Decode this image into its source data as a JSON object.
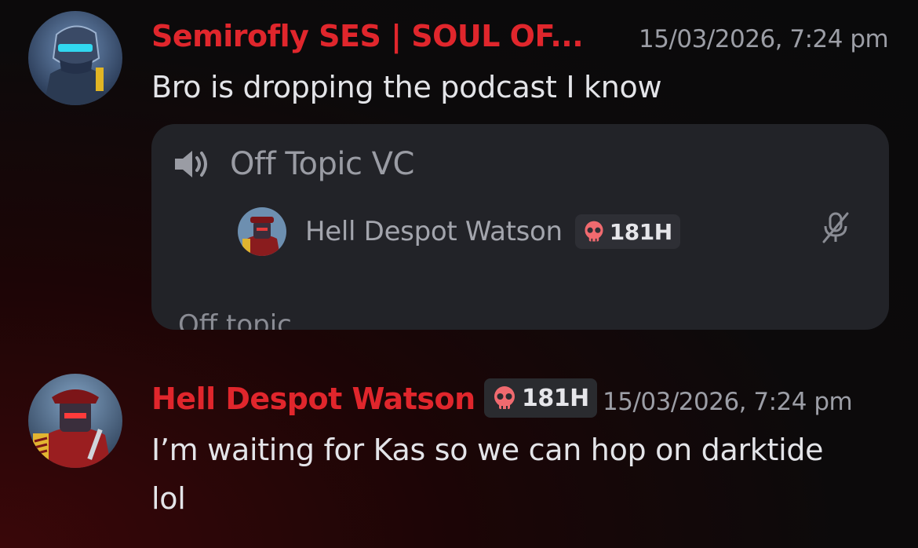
{
  "messages": [
    {
      "author": "Semirofly SES | SOUL OF...",
      "timestamp": "15/03/2026, 7:24 pm",
      "text": "Bro is dropping the podcast I know",
      "avatar_icon": "armored-soldier-avatar",
      "embed": {
        "channel_name": "Off Topic VC",
        "icon": "speaker-icon",
        "member": {
          "name": "Hell Despot Watson",
          "badge_text": "181H",
          "badge_icon": "skull-icon",
          "status_icon": "muted-mic-icon"
        },
        "footer_text": "Off topic"
      }
    },
    {
      "author": "Hell Despot Watson",
      "badge_text": "181H",
      "badge_icon": "skull-icon",
      "timestamp": "15/03/2026, 7:24 pm",
      "text_line1": "I’m waiting for Kas so we can hop on darktide",
      "text_line2": "lol",
      "avatar_icon": "commissar-avatar"
    }
  ],
  "colors": {
    "author": "#e0262c",
    "badge_skull": "#f06a6f",
    "embed_bg": "#222328"
  }
}
